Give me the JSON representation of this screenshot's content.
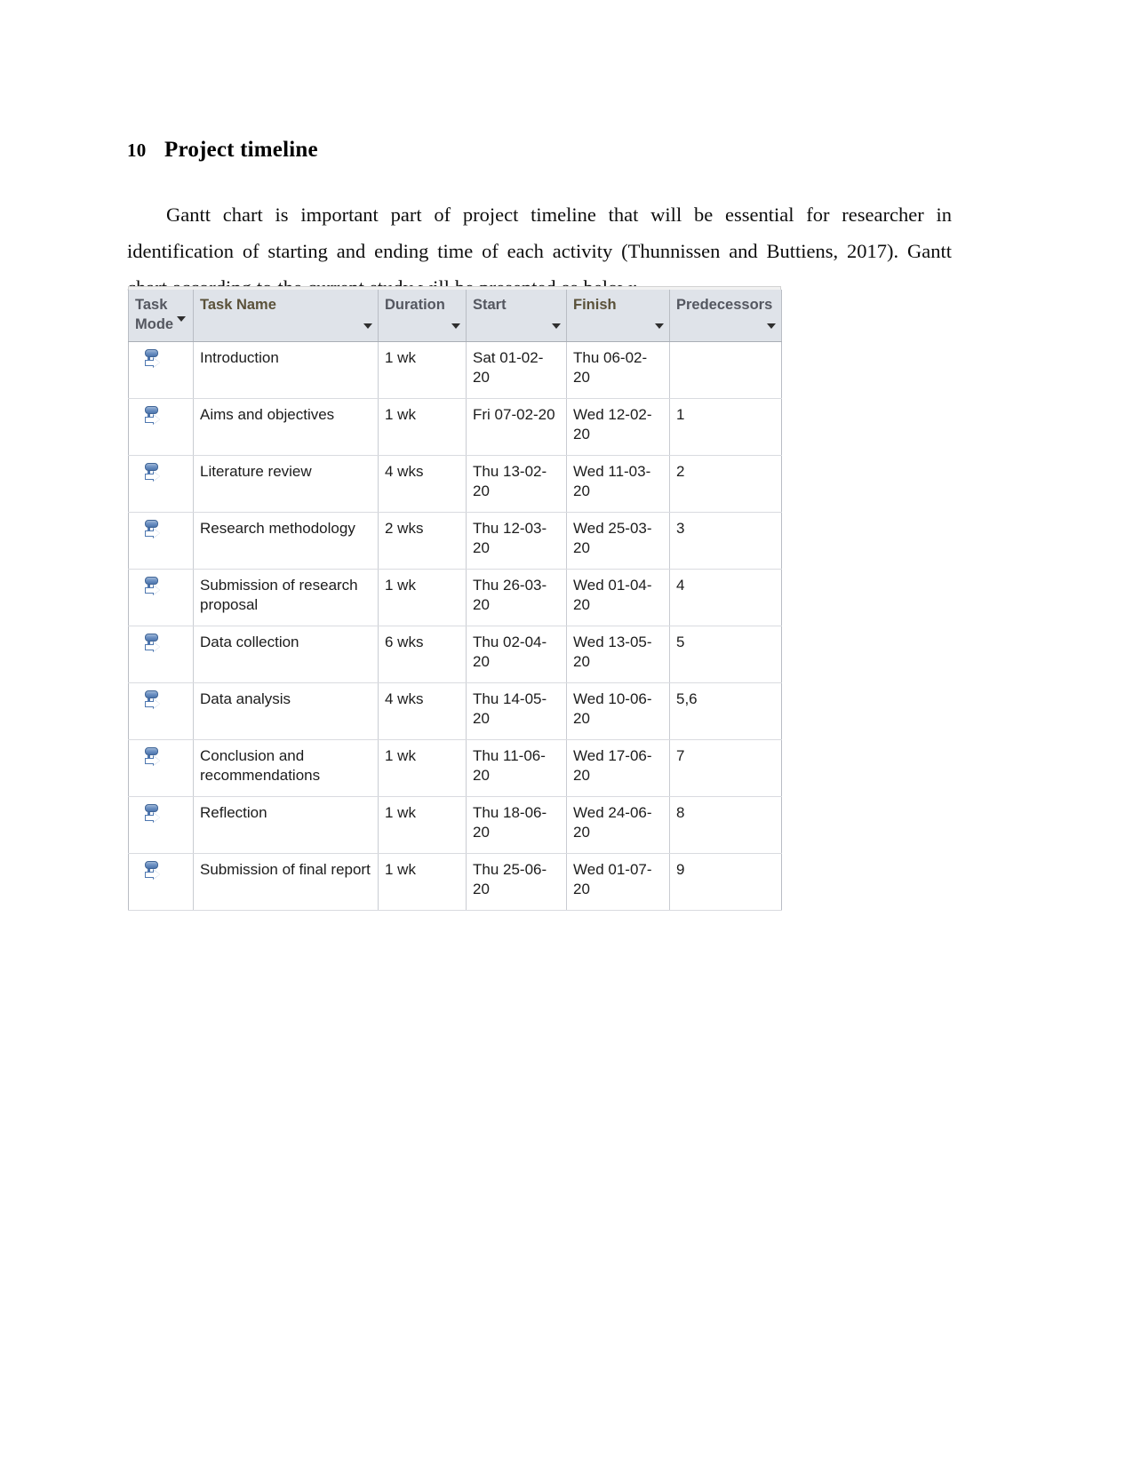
{
  "document": {
    "heading": {
      "number": "10",
      "title": "Project timeline"
    },
    "paragraph": "Gantt chart is important part of project timeline that will be essential for researcher in identification of starting and ending time of each activity (Thunnissen and Buttiens, 2017). Gantt chart according to the current study will be presented as below:"
  },
  "colors": {
    "header_gray": "#dfe3e9",
    "header_yellow": "#fcd45f",
    "header_yellow_light": "#fdf3d2",
    "grid_line": "#c9ccd2",
    "icon_blue": "#4d75ad",
    "text": "#1c1c1c"
  },
  "project_table": {
    "columns": [
      {
        "key": "task_mode",
        "label": "Task Mode",
        "style": "gray",
        "filter_icon": "chevron-down-icon"
      },
      {
        "key": "task_name",
        "label": "Task Name",
        "style": "yellow-grad",
        "filter_icon": "chevron-down-icon"
      },
      {
        "key": "duration",
        "label": "Duration",
        "style": "gray",
        "filter_icon": "chevron-down-icon"
      },
      {
        "key": "start",
        "label": "Start",
        "style": "gray",
        "filter_icon": "chevron-down-icon"
      },
      {
        "key": "finish",
        "label": "Finish",
        "style": "yellow-solid",
        "filter_icon": "chevron-down-icon"
      },
      {
        "key": "predecessors",
        "label": "Predecessors",
        "style": "gray",
        "filter_icon": "chevron-down-icon"
      }
    ],
    "rows": [
      {
        "mode_icon": "manually-scheduled-icon",
        "task_name": "Introduction",
        "duration": "1 wk",
        "start": "Sat 01-02-20",
        "finish": "Thu 06-02-20",
        "predecessors": ""
      },
      {
        "mode_icon": "manually-scheduled-icon",
        "task_name": "Aims and objectives",
        "duration": "1 wk",
        "start": "Fri 07-02-20",
        "finish": "Wed 12-02-20",
        "predecessors": "1"
      },
      {
        "mode_icon": "manually-scheduled-icon",
        "task_name": "Literature review",
        "duration": "4 wks",
        "start": "Thu 13-02-20",
        "finish": "Wed 11-03-20",
        "predecessors": "2"
      },
      {
        "mode_icon": "manually-scheduled-icon",
        "task_name": "Research methodology",
        "duration": "2 wks",
        "start": "Thu 12-03-20",
        "finish": "Wed 25-03-20",
        "predecessors": "3"
      },
      {
        "mode_icon": "manually-scheduled-icon",
        "task_name": "Submission of research proposal",
        "duration": "1 wk",
        "start": "Thu 26-03-20",
        "finish": "Wed 01-04-20",
        "predecessors": "4"
      },
      {
        "mode_icon": "manually-scheduled-icon",
        "task_name": "Data collection",
        "duration": "6 wks",
        "start": "Thu 02-04-20",
        "finish": "Wed 13-05-20",
        "predecessors": "5"
      },
      {
        "mode_icon": "manually-scheduled-icon",
        "task_name": "Data analysis",
        "duration": "4 wks",
        "start": "Thu 14-05-20",
        "finish": "Wed 10-06-20",
        "predecessors": "5,6"
      },
      {
        "mode_icon": "manually-scheduled-icon",
        "task_name": "Conclusion and recommendations",
        "duration": "1 wk",
        "start": "Thu 11-06-20",
        "finish": "Wed 17-06-20",
        "predecessors": "7"
      },
      {
        "mode_icon": "manually-scheduled-icon",
        "task_name": "Reflection",
        "duration": "1 wk",
        "start": "Thu 18-06-20",
        "finish": "Wed 24-06-20",
        "predecessors": "8"
      },
      {
        "mode_icon": "manually-scheduled-icon",
        "task_name": "Submission of final report",
        "duration": "1 wk",
        "start": "Thu 25-06-20",
        "finish": "Wed 01-07-20",
        "predecessors": "9"
      }
    ]
  }
}
